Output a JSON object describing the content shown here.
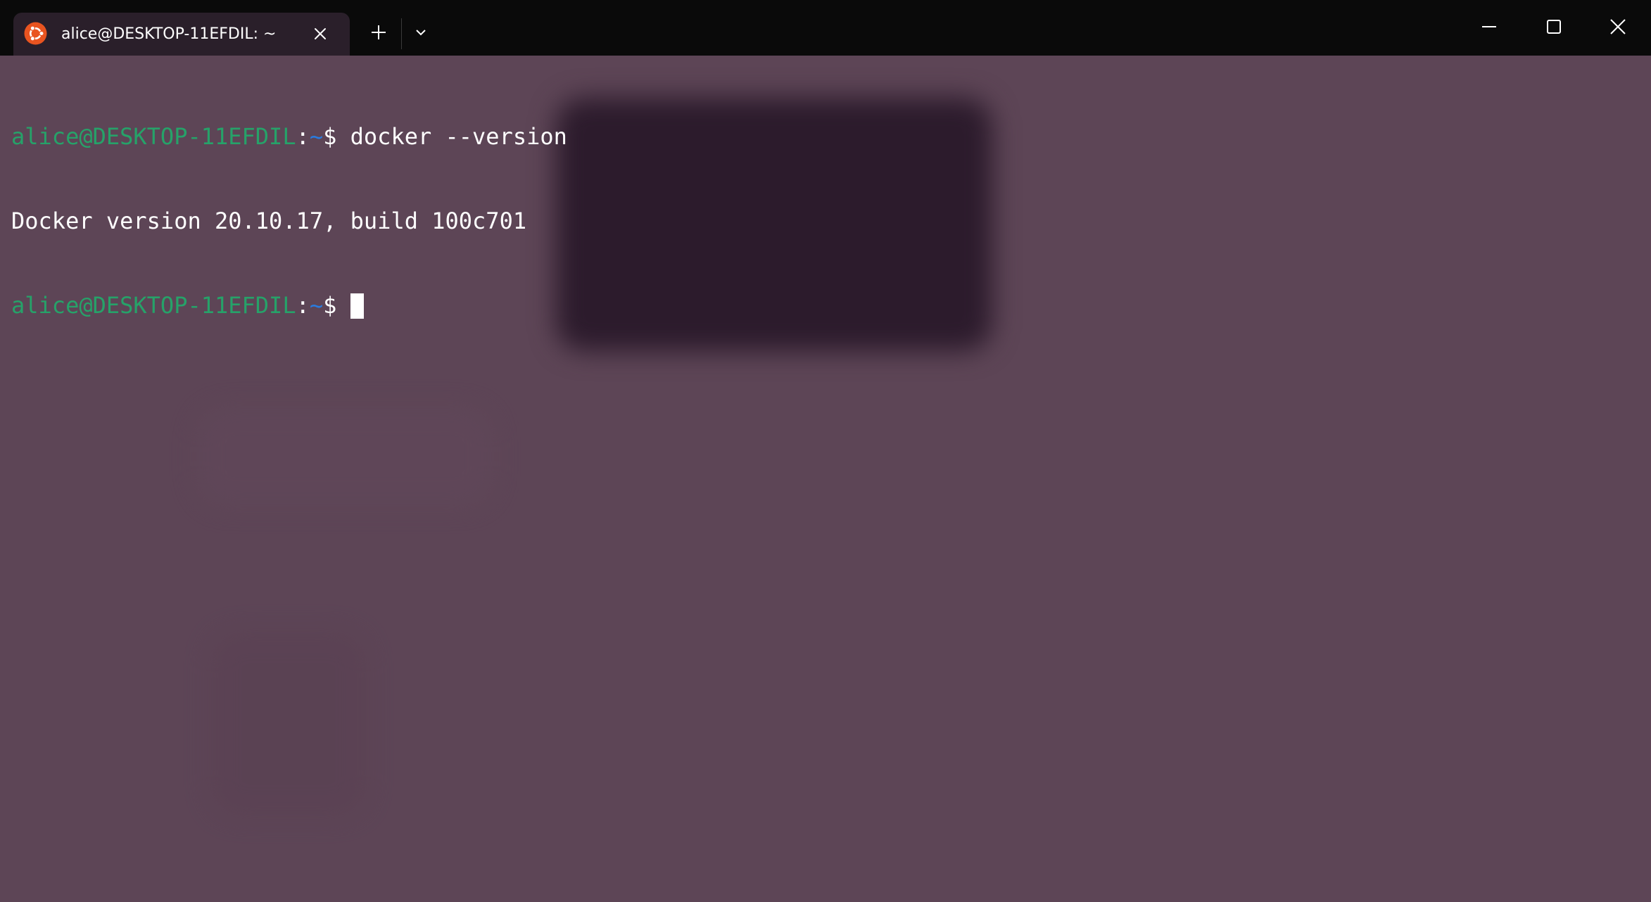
{
  "tab": {
    "title": "alice@DESKTOP-11EFDIL: ~",
    "icon": "ubuntu-icon",
    "icon_color": "#e95420"
  },
  "titlebar_buttons": {
    "new_tab": "plus-icon",
    "dropdown": "chevron-down-icon",
    "minimize": "minimize-icon",
    "maximize": "maximize-icon",
    "close": "close-icon"
  },
  "terminal": {
    "background": "#5d4556",
    "lines": [
      {
        "user": "alice@DESKTOP-11EFDIL",
        "colon": ":",
        "path": "~",
        "dollar": "$ ",
        "command": "docker --version"
      },
      {
        "output": "Docker version 20.10.17, build 100c701"
      },
      {
        "user": "alice@DESKTOP-11EFDIL",
        "colon": ":",
        "path": "~",
        "dollar": "$ ",
        "command": ""
      }
    ],
    "prompt_user_color": "#26a269",
    "prompt_path_color": "#2a7bde"
  }
}
